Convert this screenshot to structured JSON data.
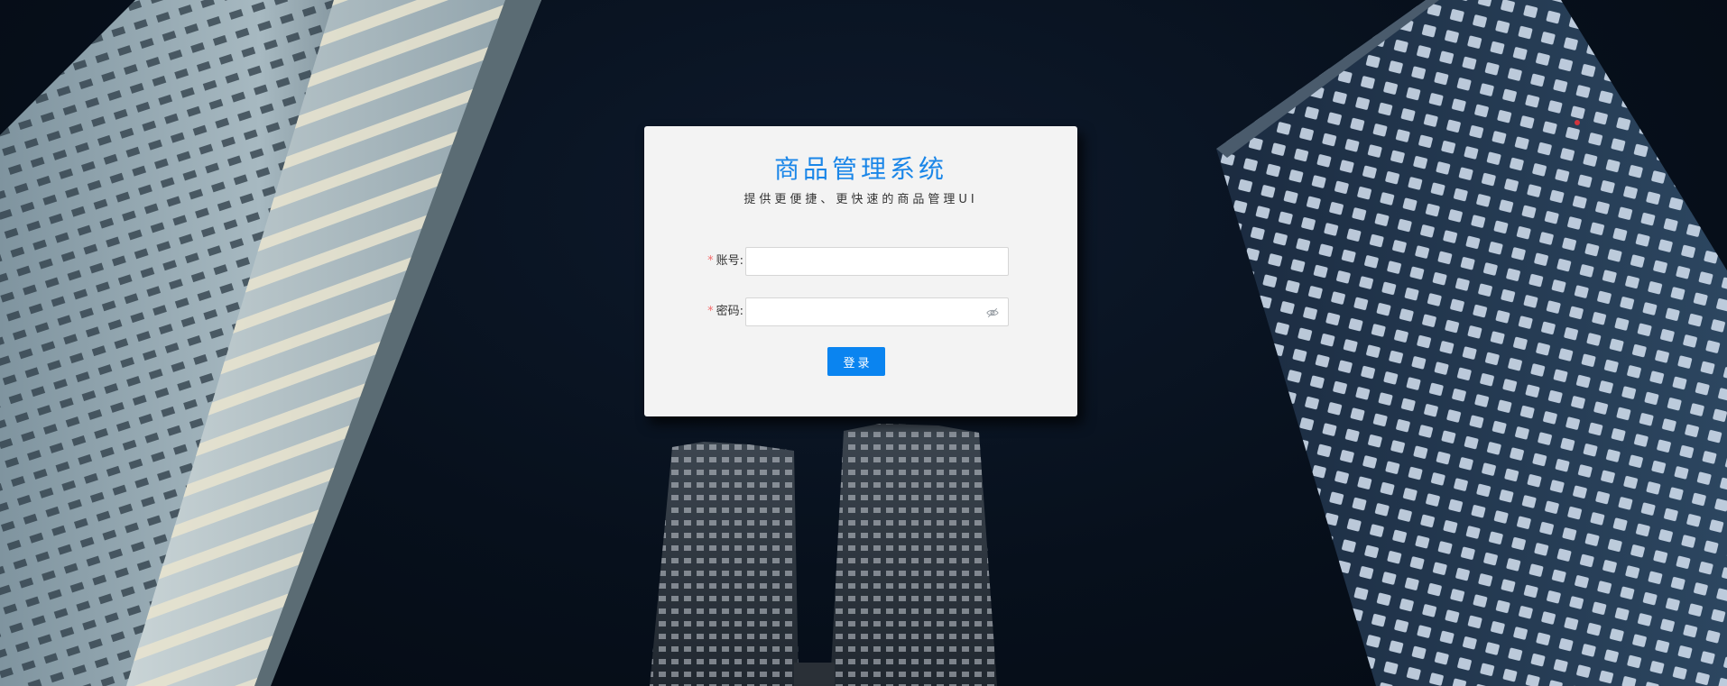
{
  "login": {
    "title": "商品管理系统",
    "subtitle": "提供更便捷、更快速的商品管理UI",
    "account": {
      "required_mark": "*",
      "label": "账号:",
      "value": "",
      "placeholder": ""
    },
    "password": {
      "required_mark": "*",
      "label": "密码:",
      "value": "",
      "placeholder": "",
      "toggle_icon": "eye-hidden-icon"
    },
    "submit_label": "登录"
  },
  "background": {
    "scene": "night city skyscrapers"
  },
  "colors": {
    "accent": "#0a84f0",
    "title": "#1a86e8",
    "required": "#f56c6c",
    "card_bg": "#f3f3f3"
  }
}
